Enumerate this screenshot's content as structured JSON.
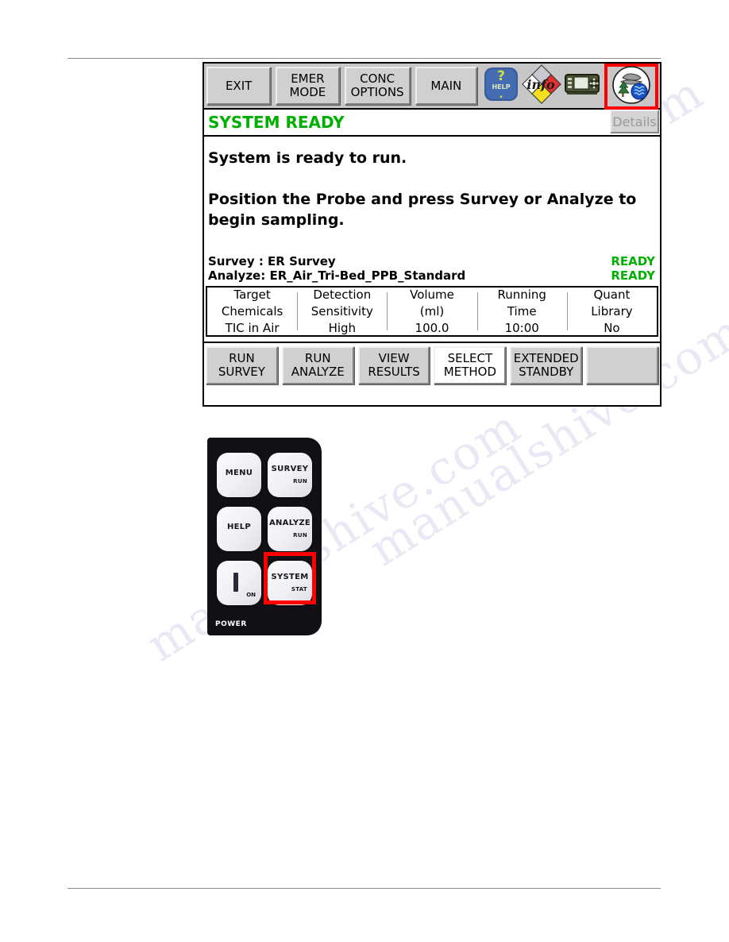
{
  "device_screen": {
    "toolbar": {
      "buttons": [
        {
          "name": "exit",
          "line1": "EXIT",
          "line2": ""
        },
        {
          "name": "emer-mode",
          "line1": "EMER",
          "line2": "MODE"
        },
        {
          "name": "conc-options",
          "line1": "CONC",
          "line2": "OPTIONS"
        },
        {
          "name": "main",
          "line1": "MAIN",
          "line2": ""
        }
      ],
      "icons": [
        {
          "name": "help-icon",
          "label": "HELP"
        },
        {
          "name": "info-icon",
          "label": "info"
        },
        {
          "name": "instrument-icon",
          "label": "instrument"
        },
        {
          "name": "environment-icon",
          "label": "environment"
        }
      ],
      "highlighted_icon": "environment-icon",
      "highlight_color": "#ff0000"
    },
    "status": {
      "text": "SYSTEM READY",
      "color": "#00b000",
      "details_label": "Details"
    },
    "message": {
      "line1": "System is ready to run.",
      "line2": "Position the Probe and press Survey or Analyze to",
      "line3": "begin sampling."
    },
    "method_summary": [
      {
        "label": "Survey  : ER Survey",
        "state": "READY"
      },
      {
        "label": "Analyze: ER_Air_Tri-Bed_PPB_Standard",
        "state": "READY"
      }
    ],
    "info_table": {
      "columns": [
        {
          "header_line1": "Target",
          "header_line2": "Chemicals",
          "value": "TIC in Air"
        },
        {
          "header_line1": "Detection",
          "header_line2": "Sensitivity",
          "value": "High"
        },
        {
          "header_line1": "Volume",
          "header_line2": "(ml)",
          "value": "100.0"
        },
        {
          "header_line1": "Running",
          "header_line2": "Time",
          "value": "10:00"
        },
        {
          "header_line1": "Quant",
          "header_line2": "Library",
          "value": "No"
        }
      ]
    },
    "function_buttons": [
      {
        "name": "run-survey",
        "line1": "RUN",
        "line2": "SURVEY",
        "active": false
      },
      {
        "name": "run-analyze",
        "line1": "RUN",
        "line2": "ANALYZE",
        "active": false
      },
      {
        "name": "view-results",
        "line1": "VIEW",
        "line2": "RESULTS",
        "active": false
      },
      {
        "name": "select-method",
        "line1": "SELECT",
        "line2": "METHOD",
        "active": true
      },
      {
        "name": "extended-standby",
        "line1": "EXTENDED",
        "line2": "STANDBY",
        "active": false
      },
      {
        "name": "blank",
        "line1": "",
        "line2": "",
        "active": false
      }
    ]
  },
  "keypad": {
    "keys": [
      {
        "name": "menu",
        "main": "MENU",
        "sub": ""
      },
      {
        "name": "survey",
        "main": "SURVEY",
        "sub": "RUN"
      },
      {
        "name": "help",
        "main": "HELP",
        "sub": ""
      },
      {
        "name": "analyze",
        "main": "ANALYZE",
        "sub": "RUN"
      },
      {
        "name": "power",
        "main": "",
        "sub": "ON"
      },
      {
        "name": "system",
        "main": "SYSTEM",
        "sub": "STAT"
      }
    ],
    "power_label": "POWER",
    "highlighted_key": "system",
    "highlight_color": "#ff0000"
  },
  "watermark": {
    "lines": [
      "manualshive.com",
      "manualshive.com",
      "manualshive.com"
    ]
  }
}
